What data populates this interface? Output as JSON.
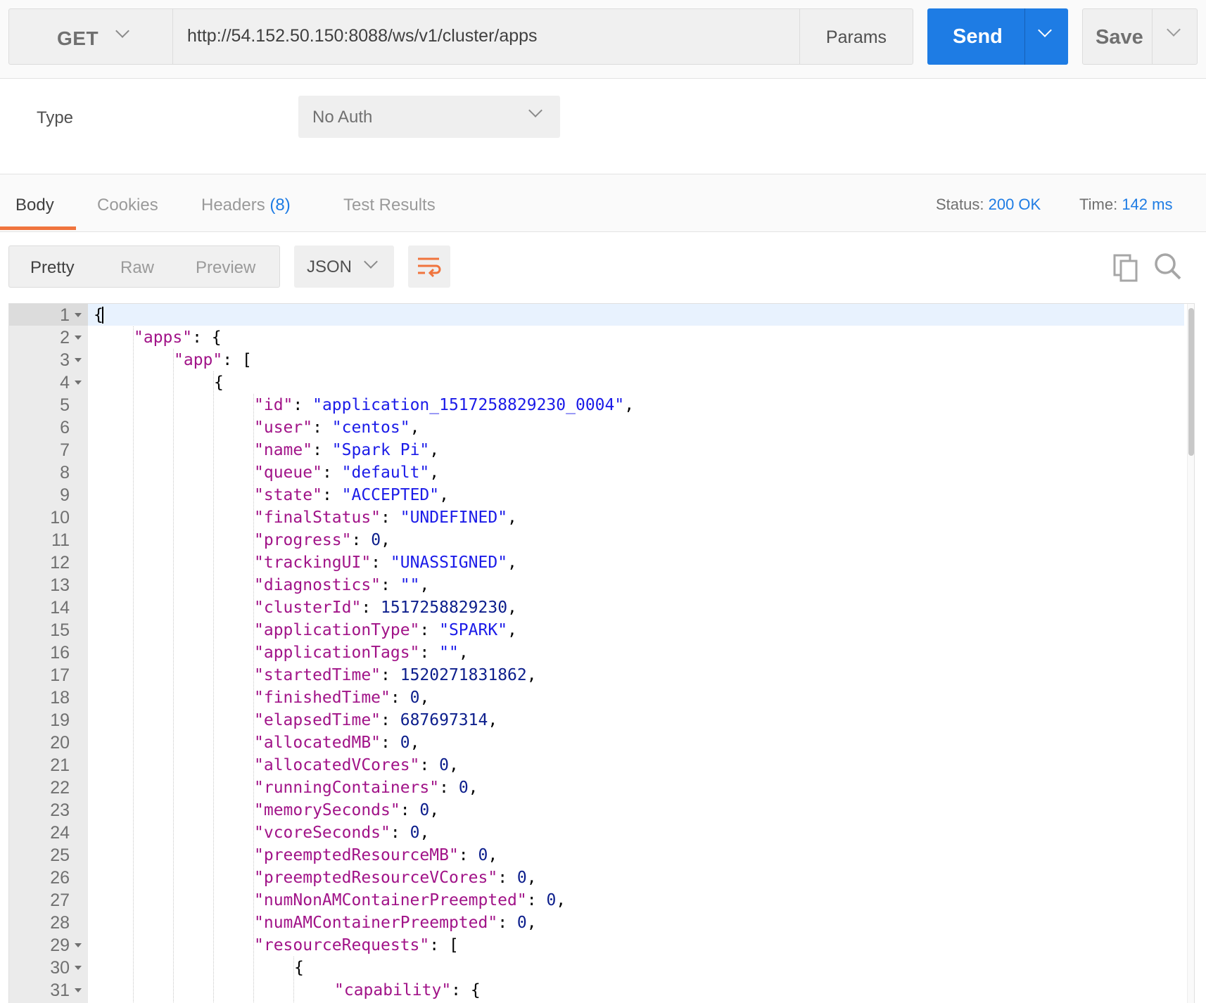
{
  "request": {
    "method": "GET",
    "url": "http://54.152.50.150:8088/ws/v1/cluster/apps",
    "params_label": "Params",
    "send_label": "Send",
    "save_label": "Save"
  },
  "auth": {
    "type_label": "Type",
    "type_value": "No Auth"
  },
  "response_tabs": {
    "body": "Body",
    "cookies": "Cookies",
    "headers": "Headers",
    "headers_count": "(8)",
    "test_results": "Test Results"
  },
  "response_meta": {
    "status_label": "Status:",
    "status_value": "200 OK",
    "time_label": "Time:",
    "time_value": "142 ms"
  },
  "body_toolbar": {
    "pretty": "Pretty",
    "raw": "Raw",
    "preview": "Preview",
    "format": "JSON",
    "icons": [
      "wrap-lines-icon",
      "copy-icon",
      "search-icon"
    ]
  },
  "colors": {
    "accent": "#1e7ce4",
    "tab_underline": "#f0743d",
    "json_key": "#a11388",
    "json_string": "#1b1be8",
    "json_number": "#0c1e8c"
  },
  "code_lines": [
    {
      "num": "1",
      "fold": true,
      "indent": 0,
      "tokens": [
        [
          "p",
          "{"
        ]
      ]
    },
    {
      "num": "2",
      "fold": true,
      "indent": 1,
      "tokens": [
        [
          "k",
          "\"apps\""
        ],
        [
          "p",
          ": {"
        ]
      ]
    },
    {
      "num": "3",
      "fold": true,
      "indent": 2,
      "tokens": [
        [
          "k",
          "\"app\""
        ],
        [
          "p",
          ": ["
        ]
      ]
    },
    {
      "num": "4",
      "fold": true,
      "indent": 3,
      "tokens": [
        [
          "p",
          "{"
        ]
      ]
    },
    {
      "num": "5",
      "fold": false,
      "indent": 4,
      "tokens": [
        [
          "k",
          "\"id\""
        ],
        [
          "p",
          ": "
        ],
        [
          "s",
          "\"application_1517258829230_0004\""
        ],
        [
          "p",
          ","
        ]
      ]
    },
    {
      "num": "6",
      "fold": false,
      "indent": 4,
      "tokens": [
        [
          "k",
          "\"user\""
        ],
        [
          "p",
          ": "
        ],
        [
          "s",
          "\"centos\""
        ],
        [
          "p",
          ","
        ]
      ]
    },
    {
      "num": "7",
      "fold": false,
      "indent": 4,
      "tokens": [
        [
          "k",
          "\"name\""
        ],
        [
          "p",
          ": "
        ],
        [
          "s",
          "\"Spark Pi\""
        ],
        [
          "p",
          ","
        ]
      ]
    },
    {
      "num": "8",
      "fold": false,
      "indent": 4,
      "tokens": [
        [
          "k",
          "\"queue\""
        ],
        [
          "p",
          ": "
        ],
        [
          "s",
          "\"default\""
        ],
        [
          "p",
          ","
        ]
      ]
    },
    {
      "num": "9",
      "fold": false,
      "indent": 4,
      "tokens": [
        [
          "k",
          "\"state\""
        ],
        [
          "p",
          ": "
        ],
        [
          "s",
          "\"ACCEPTED\""
        ],
        [
          "p",
          ","
        ]
      ]
    },
    {
      "num": "10",
      "fold": false,
      "indent": 4,
      "tokens": [
        [
          "k",
          "\"finalStatus\""
        ],
        [
          "p",
          ": "
        ],
        [
          "s",
          "\"UNDEFINED\""
        ],
        [
          "p",
          ","
        ]
      ]
    },
    {
      "num": "11",
      "fold": false,
      "indent": 4,
      "tokens": [
        [
          "k",
          "\"progress\""
        ],
        [
          "p",
          ": "
        ],
        [
          "n",
          "0"
        ],
        [
          "p",
          ","
        ]
      ]
    },
    {
      "num": "12",
      "fold": false,
      "indent": 4,
      "tokens": [
        [
          "k",
          "\"trackingUI\""
        ],
        [
          "p",
          ": "
        ],
        [
          "s",
          "\"UNASSIGNED\""
        ],
        [
          "p",
          ","
        ]
      ]
    },
    {
      "num": "13",
      "fold": false,
      "indent": 4,
      "tokens": [
        [
          "k",
          "\"diagnostics\""
        ],
        [
          "p",
          ": "
        ],
        [
          "s",
          "\"\""
        ],
        [
          "p",
          ","
        ]
      ]
    },
    {
      "num": "14",
      "fold": false,
      "indent": 4,
      "tokens": [
        [
          "k",
          "\"clusterId\""
        ],
        [
          "p",
          ": "
        ],
        [
          "n",
          "1517258829230"
        ],
        [
          "p",
          ","
        ]
      ]
    },
    {
      "num": "15",
      "fold": false,
      "indent": 4,
      "tokens": [
        [
          "k",
          "\"applicationType\""
        ],
        [
          "p",
          ": "
        ],
        [
          "s",
          "\"SPARK\""
        ],
        [
          "p",
          ","
        ]
      ]
    },
    {
      "num": "16",
      "fold": false,
      "indent": 4,
      "tokens": [
        [
          "k",
          "\"applicationTags\""
        ],
        [
          "p",
          ": "
        ],
        [
          "s",
          "\"\""
        ],
        [
          "p",
          ","
        ]
      ]
    },
    {
      "num": "17",
      "fold": false,
      "indent": 4,
      "tokens": [
        [
          "k",
          "\"startedTime\""
        ],
        [
          "p",
          ": "
        ],
        [
          "n",
          "1520271831862"
        ],
        [
          "p",
          ","
        ]
      ]
    },
    {
      "num": "18",
      "fold": false,
      "indent": 4,
      "tokens": [
        [
          "k",
          "\"finishedTime\""
        ],
        [
          "p",
          ": "
        ],
        [
          "n",
          "0"
        ],
        [
          "p",
          ","
        ]
      ]
    },
    {
      "num": "19",
      "fold": false,
      "indent": 4,
      "tokens": [
        [
          "k",
          "\"elapsedTime\""
        ],
        [
          "p",
          ": "
        ],
        [
          "n",
          "687697314"
        ],
        [
          "p",
          ","
        ]
      ]
    },
    {
      "num": "20",
      "fold": false,
      "indent": 4,
      "tokens": [
        [
          "k",
          "\"allocatedMB\""
        ],
        [
          "p",
          ": "
        ],
        [
          "n",
          "0"
        ],
        [
          "p",
          ","
        ]
      ]
    },
    {
      "num": "21",
      "fold": false,
      "indent": 4,
      "tokens": [
        [
          "k",
          "\"allocatedVCores\""
        ],
        [
          "p",
          ": "
        ],
        [
          "n",
          "0"
        ],
        [
          "p",
          ","
        ]
      ]
    },
    {
      "num": "22",
      "fold": false,
      "indent": 4,
      "tokens": [
        [
          "k",
          "\"runningContainers\""
        ],
        [
          "p",
          ": "
        ],
        [
          "n",
          "0"
        ],
        [
          "p",
          ","
        ]
      ]
    },
    {
      "num": "23",
      "fold": false,
      "indent": 4,
      "tokens": [
        [
          "k",
          "\"memorySeconds\""
        ],
        [
          "p",
          ": "
        ],
        [
          "n",
          "0"
        ],
        [
          "p",
          ","
        ]
      ]
    },
    {
      "num": "24",
      "fold": false,
      "indent": 4,
      "tokens": [
        [
          "k",
          "\"vcoreSeconds\""
        ],
        [
          "p",
          ": "
        ],
        [
          "n",
          "0"
        ],
        [
          "p",
          ","
        ]
      ]
    },
    {
      "num": "25",
      "fold": false,
      "indent": 4,
      "tokens": [
        [
          "k",
          "\"preemptedResourceMB\""
        ],
        [
          "p",
          ": "
        ],
        [
          "n",
          "0"
        ],
        [
          "p",
          ","
        ]
      ]
    },
    {
      "num": "26",
      "fold": false,
      "indent": 4,
      "tokens": [
        [
          "k",
          "\"preemptedResourceVCores\""
        ],
        [
          "p",
          ": "
        ],
        [
          "n",
          "0"
        ],
        [
          "p",
          ","
        ]
      ]
    },
    {
      "num": "27",
      "fold": false,
      "indent": 4,
      "tokens": [
        [
          "k",
          "\"numNonAMContainerPreempted\""
        ],
        [
          "p",
          ": "
        ],
        [
          "n",
          "0"
        ],
        [
          "p",
          ","
        ]
      ]
    },
    {
      "num": "28",
      "fold": false,
      "indent": 4,
      "tokens": [
        [
          "k",
          "\"numAMContainerPreempted\""
        ],
        [
          "p",
          ": "
        ],
        [
          "n",
          "0"
        ],
        [
          "p",
          ","
        ]
      ]
    },
    {
      "num": "29",
      "fold": true,
      "indent": 4,
      "tokens": [
        [
          "k",
          "\"resourceRequests\""
        ],
        [
          "p",
          ": ["
        ]
      ]
    },
    {
      "num": "30",
      "fold": true,
      "indent": 5,
      "tokens": [
        [
          "p",
          "{"
        ]
      ]
    },
    {
      "num": "31",
      "fold": true,
      "indent": 6,
      "tokens": [
        [
          "k",
          "\"capability\""
        ],
        [
          "p",
          ": {"
        ]
      ]
    }
  ]
}
